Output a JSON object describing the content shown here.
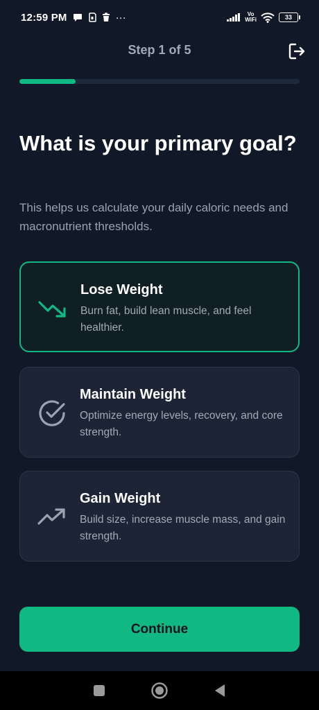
{
  "status_bar": {
    "time": "12:59 PM",
    "more": "···",
    "vowifi_top": "Vo",
    "vowifi_bottom": "WiFi",
    "battery": "33"
  },
  "header": {
    "step_text": "Step 1 of 5"
  },
  "progress": {
    "fraction": 0.2
  },
  "content": {
    "title": "What is your primary goal?",
    "subtitle": "This helps us calculate your daily caloric needs and macronutrient thresholds."
  },
  "options": [
    {
      "title": "Lose Weight",
      "description": "Burn fat, build lean muscle, and feel healthier.",
      "icon": "trending-down-icon",
      "selected": true
    },
    {
      "title": "Maintain Weight",
      "description": "Optimize energy levels, recovery, and core strength.",
      "icon": "check-circle-icon",
      "selected": false
    },
    {
      "title": "Gain Weight",
      "description": "Build size, increase muscle mass, and gain strength.",
      "icon": "trending-up-icon",
      "selected": false
    }
  ],
  "footer": {
    "continue_label": "Continue"
  },
  "colors": {
    "background": "#111827",
    "accent": "#10b981",
    "card": "#1c2436",
    "selected_card": "#0f1f24"
  }
}
